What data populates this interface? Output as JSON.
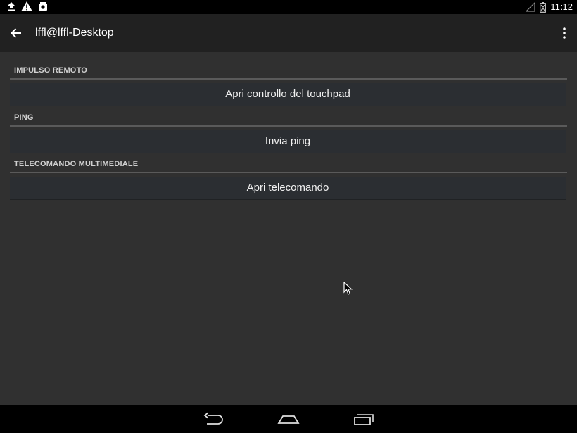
{
  "status_bar": {
    "time": "11:12",
    "left_icons": [
      "upload-icon",
      "warning-icon",
      "photo-icon"
    ],
    "right_icons": [
      "no-signal-icon",
      "battery-icon"
    ]
  },
  "action_bar": {
    "title": "lffl@lffl-Desktop",
    "back_icon": "arrow-back-icon",
    "overflow_icon": "more-vert-icon"
  },
  "sections": [
    {
      "header": "IMPULSO REMOTO",
      "button_label": "Apri controllo del touchpad"
    },
    {
      "header": "PING",
      "button_label": "Invia ping"
    },
    {
      "header": "TELECOMANDO MULTIMEDIALE",
      "button_label": "Apri telecomando"
    }
  ],
  "nav_bar": {
    "buttons": [
      "back-nav-icon",
      "home-nav-icon",
      "recents-nav-icon"
    ]
  },
  "colors": {
    "background": "#303030",
    "action_bar": "#212121",
    "button": "#2b2e32",
    "divider": "#5a5a5a"
  }
}
